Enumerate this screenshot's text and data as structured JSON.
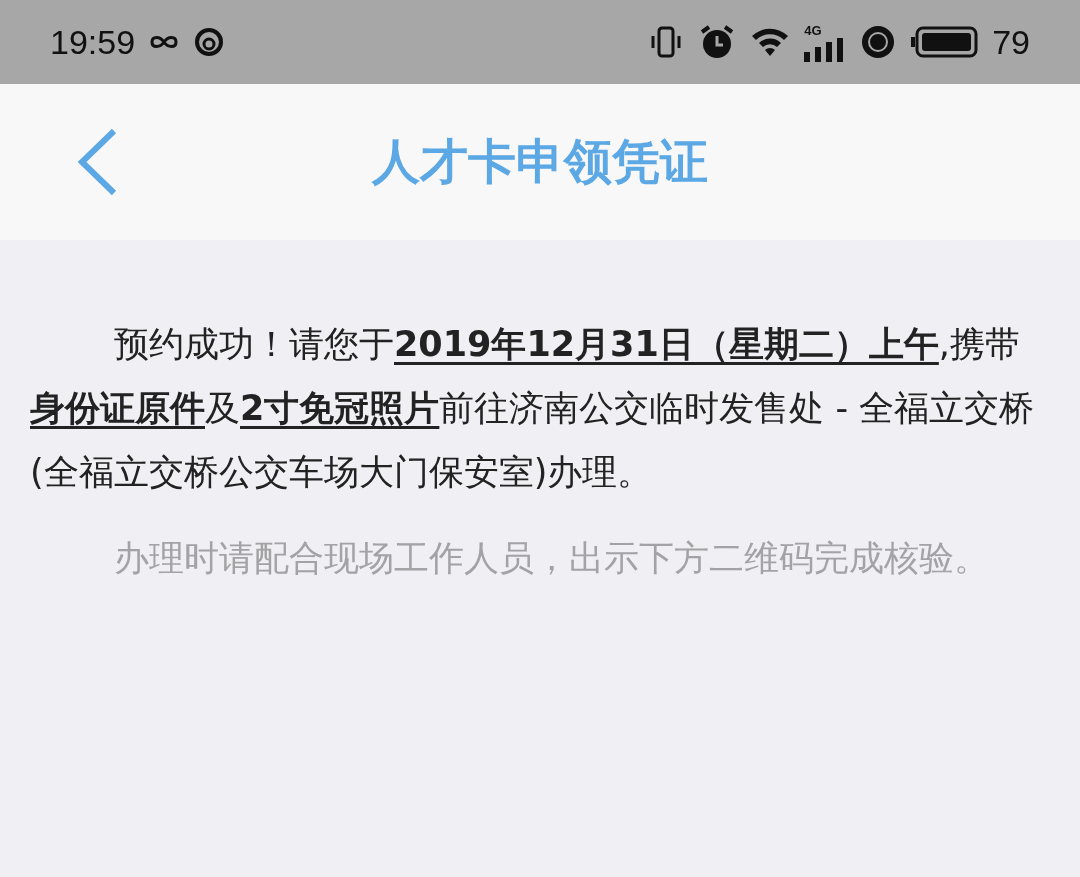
{
  "status_bar": {
    "time": "19:59",
    "network": "4G",
    "battery": "79"
  },
  "header": {
    "title": "人才卡申领凭证"
  },
  "paragraphs": [
    {
      "kind": "main",
      "text": "预约成功！请您于**2019年12月31日（星期二）上午**,携带**身份证原件**及**2寸免冠照片**前往济南公交临时发售处 - 全福立交桥(全福立交桥公交车场大门保安室)办理。"
    },
    {
      "kind": "hint",
      "text": "办理时请配合现场工作人员，出示下方二维码完成核验。"
    }
  ]
}
